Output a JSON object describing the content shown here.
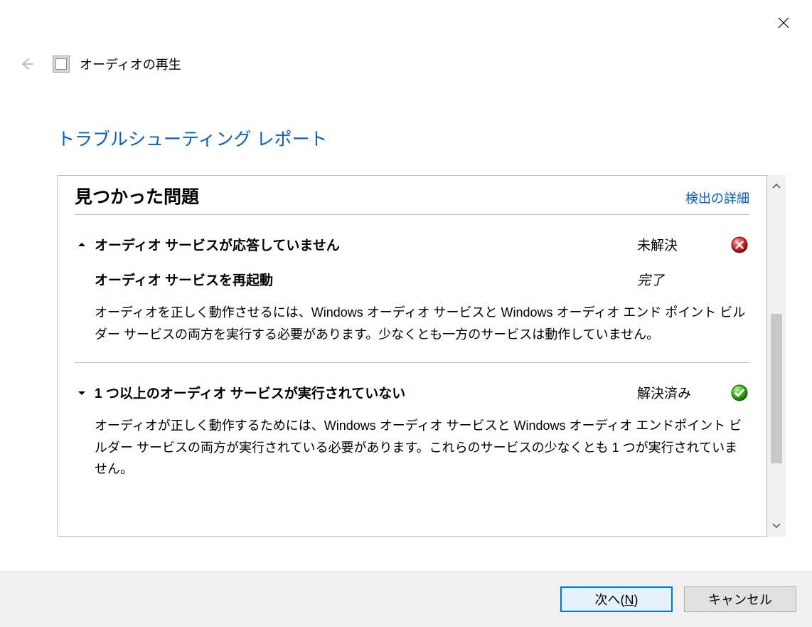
{
  "window": {
    "title": "オーディオの再生",
    "report_heading": "トラブルシューティング レポート"
  },
  "section": {
    "title": "見つかった問題",
    "details_link": "検出の詳細"
  },
  "issues": [
    {
      "expanded": true,
      "toggle_dir": "up",
      "title": "オーディオ サービスが応答していません",
      "status": "未解決",
      "status_kind": "error",
      "action_title": "オーディオ サービスを再起動",
      "action_status": "完了",
      "description": "オーディオを正しく動作させるには、Windows オーディオ サービスと Windows オーディオ エンド ポイント ビルダー サービスの両方を実行する必要があります。少なくとも一方のサービスは動作していません。"
    },
    {
      "expanded": true,
      "toggle_dir": "down",
      "title": "1 つ以上のオーディオ サービスが実行されていない",
      "status": "解決済み",
      "status_kind": "fixed",
      "action_title": "",
      "action_status": "",
      "description": "オーディオが正しく動作するためには、Windows オーディオ サービスと Windows オーディオ エンドポイント ビルダー サービスの両方が実行されている必要があります。これらのサービスの少なくとも 1 つが実行されていません。"
    }
  ],
  "buttons": {
    "next_prefix": "次へ(",
    "next_mnemonic": "N",
    "next_suffix": ")",
    "cancel": "キャンセル"
  }
}
